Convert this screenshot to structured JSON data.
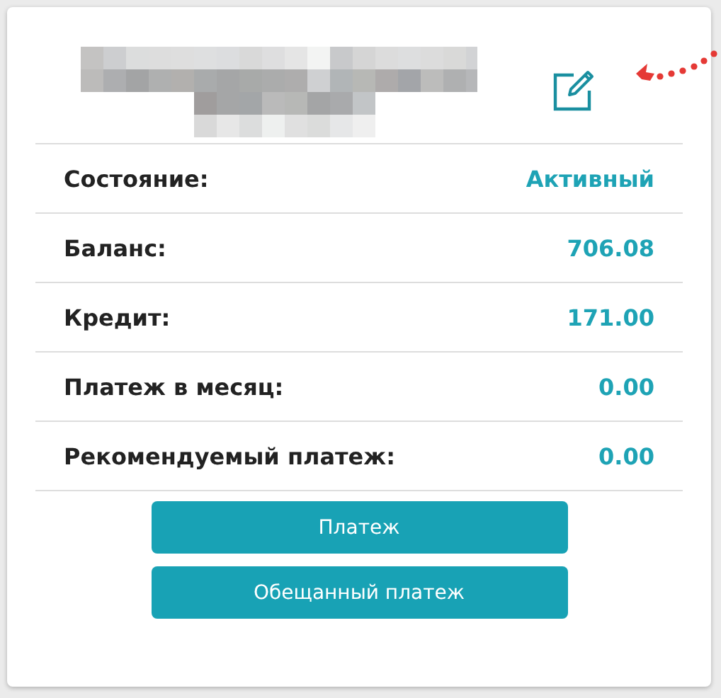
{
  "rows": [
    {
      "label": "Состояние:",
      "value": "Активный"
    },
    {
      "label": "Баланс:",
      "value": "706.08"
    },
    {
      "label": "Кредит:",
      "value": "171.00"
    },
    {
      "label": "Платеж в месяц:",
      "value": "0.00"
    },
    {
      "label": "Рекомендуемый платеж:",
      "value": "0.00"
    }
  ],
  "buttons": [
    "Платеж",
    "Обещанный платеж"
  ]
}
